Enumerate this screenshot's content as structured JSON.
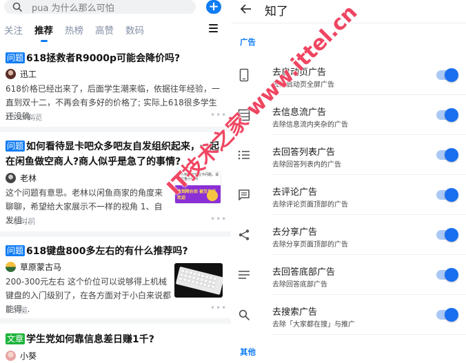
{
  "left": {
    "search": {
      "placeholder": "pua 为什么那么可怕"
    },
    "tabs": [
      "关注",
      "推荐",
      "热榜",
      "高赞",
      "数码"
    ],
    "cards": [
      {
        "tag": "问题",
        "title": "618拯救者R9000p可能会降价吗?",
        "author": "迅工",
        "excerpt": "618价格已经出来了，后面学生潮来临，依据往年经验，一直到双十二，不再会有多好的价格了; 实际上618很多学生还没确...",
        "meta": "1070 浏览"
      },
      {
        "tag": "问题",
        "title": "如何看待显卡吧众多吧友自发组织起来，一起在闲鱼做空商人?商人似乎是急了的事情?",
        "author": "老林",
        "excerpt": "这个问题有意思。老林以闲鱼商家的角度来聊聊，希望给大家展示不一样的视角 1、自发组...",
        "meta": "1 小时前",
        "thumb": {
          "caption": "本人特价收受显卡问题，请回在鱼小作用",
          "highlight": "收到降价后 被交易所欢迎"
        }
      },
      {
        "tag": "问题",
        "title": "618键盘800多左右的有什么推荐吗?",
        "author": "草原蒙古马",
        "excerpt": "200-300元左右 这个价位可以说够得上机械键盘的入门级别了，在各方面对于小白来说都能得...",
        "meta": "7 浏览"
      },
      {
        "tag": "文章",
        "title": "学生党如何靠信息差日赚1千?",
        "author": "小葵"
      }
    ],
    "colors": {
      "accent": "#0f7cf4",
      "article_tag": "#1eb33a"
    }
  },
  "right": {
    "title": "知了",
    "section_ads": "广告",
    "section_other": "其他",
    "rows": [
      {
        "icon": "phone-icon",
        "title": "去启动页广告",
        "sub": "去除启动页全屏广告",
        "on": true
      },
      {
        "icon": "feed-icon",
        "title": "去信息流广告",
        "sub": "去除信息流内夹杂的广告",
        "on": true
      },
      {
        "icon": "list-icon",
        "title": "去回答列表广告",
        "sub": "去除回答列表内的广告",
        "on": true
      },
      {
        "icon": "comment-icon",
        "title": "去评论广告",
        "sub": "去除评论页面顶部的广告",
        "on": true
      },
      {
        "icon": "share-icon",
        "title": "去分享广告",
        "sub": "去除分享页面顶部的广告",
        "on": true
      },
      {
        "icon": "lines-icon",
        "title": "去回答底部广告",
        "sub": "去除回答底部广告",
        "on": true
      },
      {
        "icon": "search-icon",
        "title": "去搜索广告",
        "sub": "去除「大家都在搜」与推广",
        "on": true
      }
    ]
  },
  "watermark": "IT技术之家 www.ittel.cn"
}
